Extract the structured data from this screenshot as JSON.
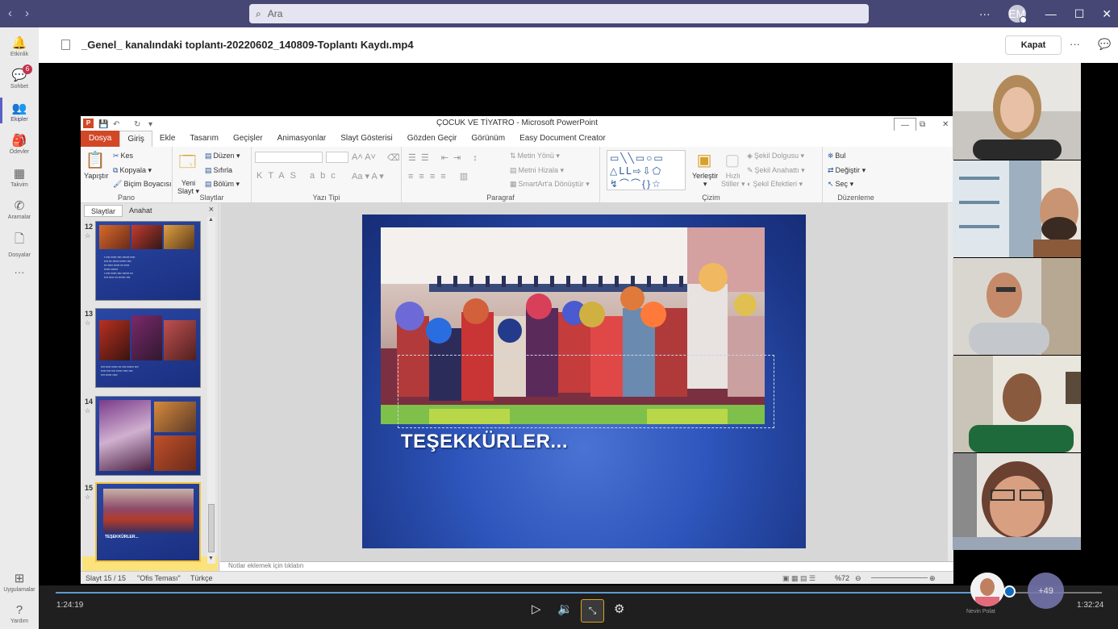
{
  "topbar": {
    "search_placeholder": "Ara",
    "more": "···",
    "avatar_initials": "EM",
    "back": "‹",
    "forward": "›"
  },
  "rail": {
    "items": [
      {
        "label": "Etkinlik",
        "icon": "bell-icon",
        "glyph": "🔔"
      },
      {
        "label": "Sohbet",
        "icon": "chat-icon",
        "glyph": "💬",
        "badge": "6"
      },
      {
        "label": "Ekipler",
        "icon": "teams-icon",
        "glyph": "👥"
      },
      {
        "label": "Ödevler",
        "icon": "assignments-icon",
        "glyph": "🎒"
      },
      {
        "label": "Takvim",
        "icon": "calendar-icon",
        "glyph": "▦"
      },
      {
        "label": "Aramalar",
        "icon": "phone-icon",
        "glyph": "✆"
      },
      {
        "label": "Dosyalar",
        "icon": "files-icon",
        "glyph": "🗋"
      },
      {
        "label": "Uygulamalar",
        "icon": "apps-icon",
        "glyph": "⊞"
      },
      {
        "label": "Yardım",
        "icon": "help-icon",
        "glyph": "?"
      }
    ],
    "more": "···"
  },
  "filebar": {
    "title": "_Genel_ kanalındaki toplantı-20220602_140809-Toplantı Kaydı.mp4",
    "close_label": "Kapat",
    "more": "···"
  },
  "ppt": {
    "window_title": "ÇOCUK VE TİYATRO  -  Microsoft PowerPoint",
    "app_letter": "P",
    "tabs": [
      "Dosya",
      "Giriş",
      "Ekle",
      "Tasarım",
      "Geçişler",
      "Animasyonlar",
      "Slayt Gösterisi",
      "Gözden Geçir",
      "Görünüm",
      "Easy Document Creator"
    ],
    "ribbon": {
      "pano": {
        "label": "Pano",
        "paste": "Yapıştır",
        "cut": "Kes",
        "copy": "Kopyala",
        "format_painter": "Biçim Boyacısı"
      },
      "slaytlar": {
        "label": "Slaytlar",
        "new_slide_line1": "Yeni",
        "new_slide_line2": "Slayt",
        "layout": "Düzen",
        "reset": "Sıfırla",
        "section": "Bölüm"
      },
      "yazitipi": {
        "label": "Yazı Tipi"
      },
      "paragraf": {
        "label": "Paragraf",
        "text_direction": "Metin Yönü",
        "align_text": "Metni Hizala",
        "smartart": "SmartArt'a Dönüştür"
      },
      "cizim": {
        "label": "Çizim",
        "arrange": "Yerleştir",
        "quick_styles_1": "Hızlı",
        "quick_styles_2": "Stiller",
        "fill": "Şekil Dolgusu",
        "outline": "Şekil Anahattı",
        "effects": "Şekil Efektleri"
      },
      "duzenleme": {
        "label": "Düzenleme",
        "find": "Bul",
        "replace": "Değiştir",
        "select": "Seç"
      }
    },
    "panel": {
      "tab_slides": "Slaytlar",
      "tab_outline": "Anahat",
      "close": "×",
      "thumbs": [
        {
          "num": "12"
        },
        {
          "num": "13"
        },
        {
          "num": "14"
        },
        {
          "num": "15",
          "caption": "TEŞEKKÜRLER..."
        }
      ]
    },
    "slide": {
      "text": "TEŞEKKÜRLER..."
    },
    "notes_placeholder": "Notlar eklemek için tıklatın",
    "status": {
      "slide": "Slayt 15 / 15",
      "theme": "\"Ofis Teması\"",
      "language": "Türkçe",
      "zoom": "%72"
    }
  },
  "controls": {
    "current_time": "1:24:19",
    "total_time": "1:32:24",
    "progress": 0.912,
    "participant_name": "Nevin Polat",
    "more_count": "+49"
  }
}
